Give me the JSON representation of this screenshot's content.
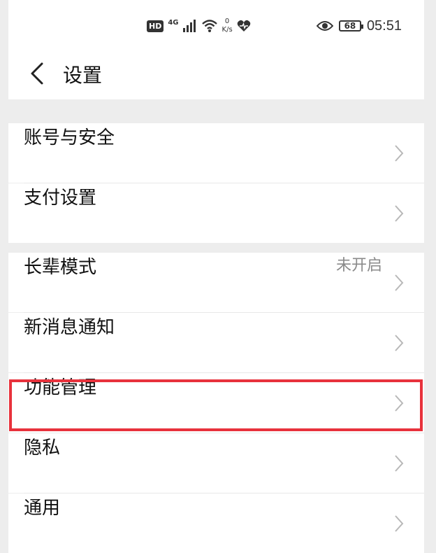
{
  "status_bar": {
    "hd": "HD",
    "network": "4G",
    "speed_value": "0",
    "speed_unit": "K/s",
    "battery": "68",
    "time": "05:51",
    "icons": [
      "signal-icon",
      "wifi-icon",
      "heart-icon",
      "eye-icon",
      "battery-icon"
    ]
  },
  "header": {
    "title": "设置"
  },
  "settings": {
    "account_security": {
      "label": "账号与安全"
    },
    "payment": {
      "label": "支付设置"
    },
    "elder_mode": {
      "label": "长辈模式",
      "value": "未开启"
    },
    "notifications": {
      "label": "新消息通知"
    },
    "features": {
      "label": "功能管理",
      "highlighted": true
    },
    "privacy": {
      "label": "隐私"
    },
    "general": {
      "label": "通用"
    }
  },
  "colors": {
    "highlight": "#e8323c",
    "background": "#ededed",
    "chevron": "#b8b8b8",
    "value_text": "#8a8a8a"
  }
}
